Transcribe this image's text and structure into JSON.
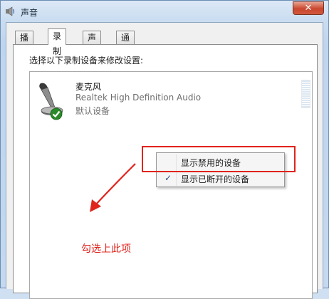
{
  "window": {
    "title": "声音",
    "close_glyph": "✕"
  },
  "tabs": [
    {
      "label": "播放",
      "active": false
    },
    {
      "label": "录制",
      "active": true
    },
    {
      "label": "声音",
      "active": false
    },
    {
      "label": "通信",
      "active": false
    }
  ],
  "panel": {
    "instruction": "选择以下录制设备来修改设置:"
  },
  "device": {
    "name": "麦克风",
    "description": "Realtek High Definition Audio",
    "status": "默认设备",
    "icon": "microphone-icon",
    "status_icon": "default-check-icon"
  },
  "context_menu": {
    "items": [
      {
        "label": "显示禁用的设备",
        "checked": false
      },
      {
        "label": "显示已断开的设备",
        "checked": true,
        "check_glyph": "✓"
      }
    ]
  },
  "annotation": {
    "text": "勾选上此项",
    "color": "#e0241c"
  },
  "colors": {
    "accent": "#2a8a2a",
    "close_button": "#c9462d",
    "annotation": "#e0241c"
  }
}
